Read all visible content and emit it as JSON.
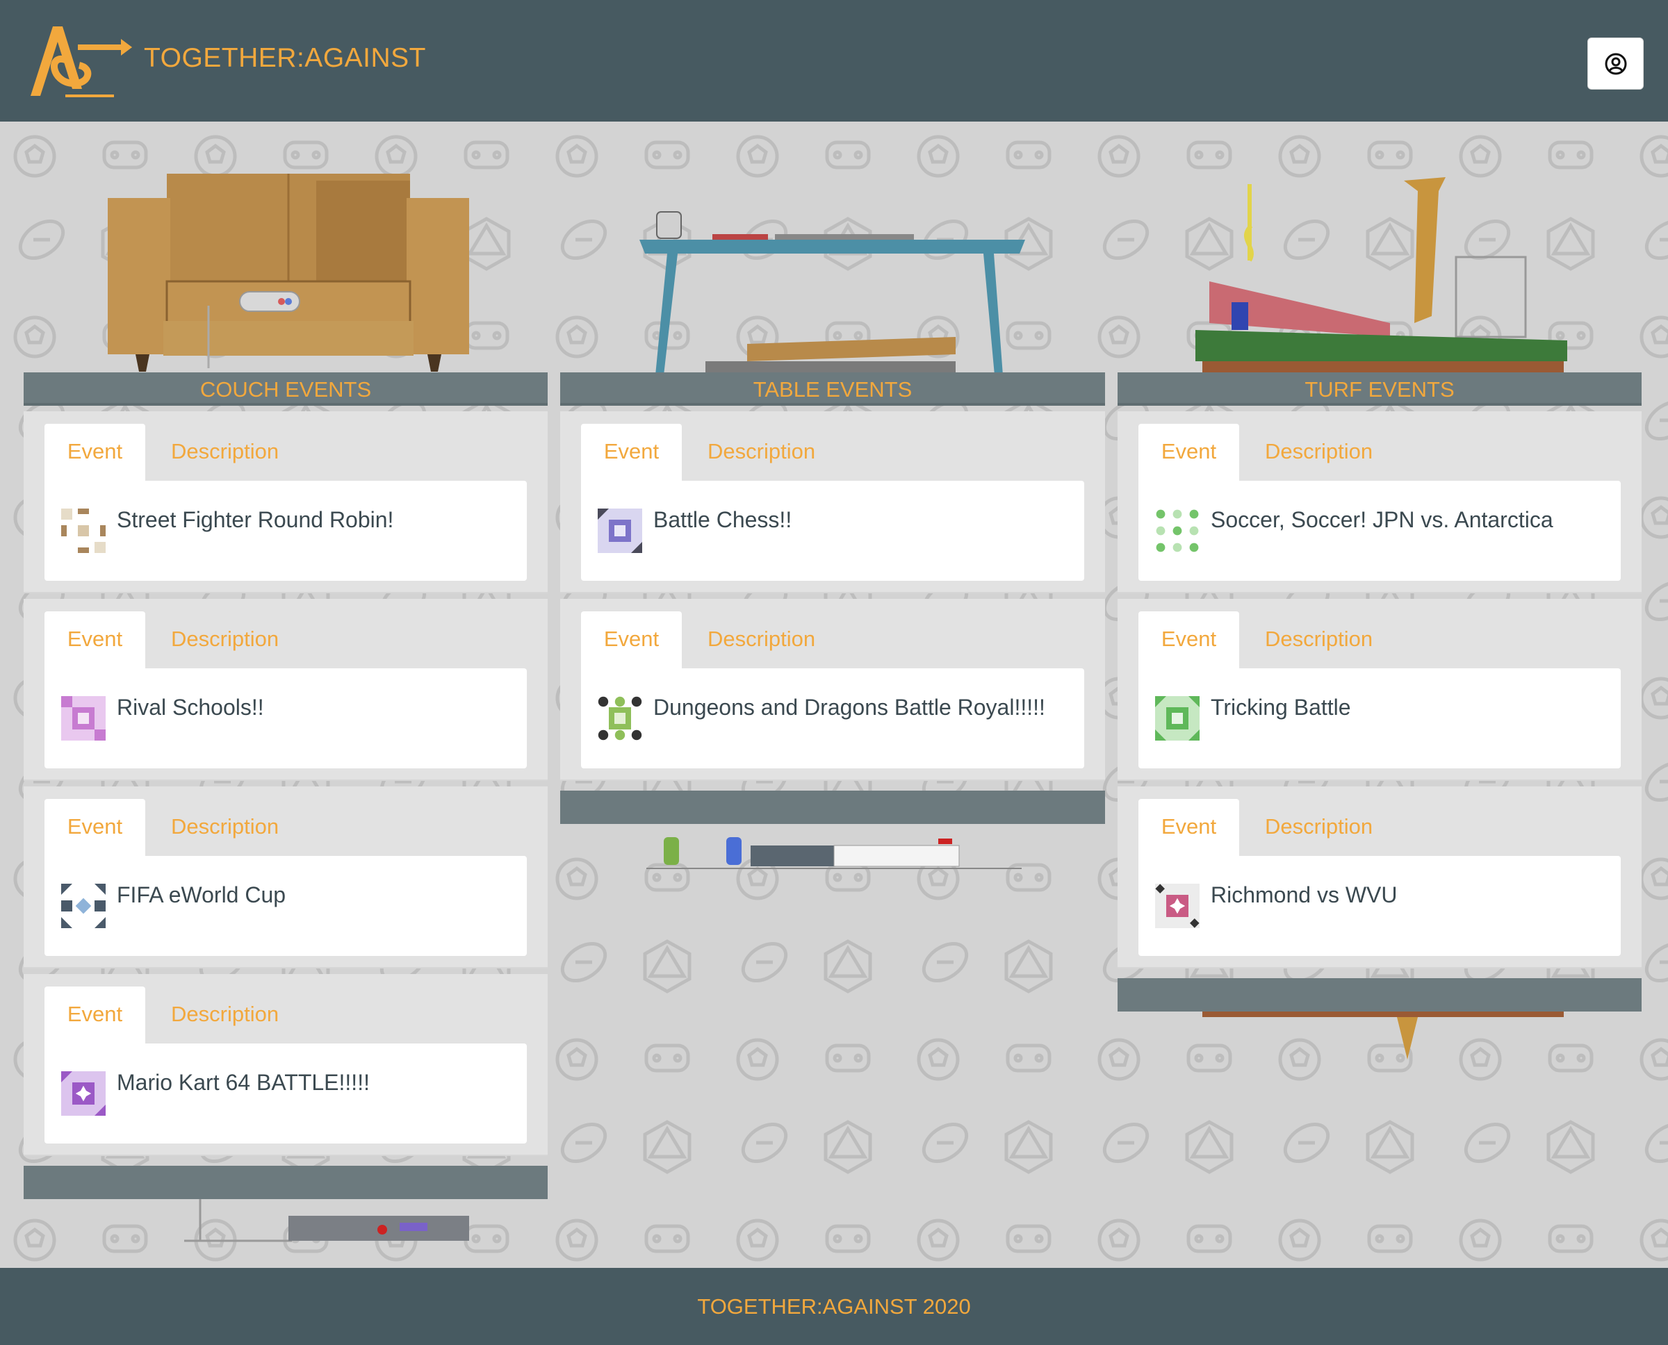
{
  "brand": {
    "name": "TOGETHER:AGAINST"
  },
  "header": {
    "account_icon": "user-circle-icon"
  },
  "columns": [
    {
      "title": "COUCH EVENTS",
      "events": [
        {
          "tab_event": "Event",
          "tab_description": "Description",
          "title": "Street Fighter Round Robin!",
          "avatar_color": "#a9865c"
        },
        {
          "tab_event": "Event",
          "tab_description": "Description",
          "title": "Rival Schools!!",
          "avatar_color": "#c77bd1"
        },
        {
          "tab_event": "Event",
          "tab_description": "Description",
          "title": "FIFA eWorld Cup",
          "avatar_color": "#4a5a6a"
        },
        {
          "tab_event": "Event",
          "tab_description": "Description",
          "title": "Mario Kart 64 BATTLE!!!!!",
          "avatar_color": "#9b59c6"
        }
      ]
    },
    {
      "title": "TABLE EVENTS",
      "events": [
        {
          "tab_event": "Event",
          "tab_description": "Description",
          "title": "Battle Chess!!",
          "avatar_color": "#7d74c9"
        },
        {
          "tab_event": "Event",
          "tab_description": "Description",
          "title": "Dungeons and Dragons Battle Royal!!!!!",
          "avatar_color": "#8fbf5a"
        }
      ]
    },
    {
      "title": "TURF EVENTS",
      "events": [
        {
          "tab_event": "Event",
          "tab_description": "Description",
          "title": "Soccer, Soccer! JPN vs. Antarctica",
          "avatar_color": "#74c46a"
        },
        {
          "tab_event": "Event",
          "tab_description": "Description",
          "title": "Tricking Battle",
          "avatar_color": "#5fb85a"
        },
        {
          "tab_event": "Event",
          "tab_description": "Description",
          "title": "Richmond vs WVU",
          "avatar_color": "#c95b84"
        }
      ]
    }
  ],
  "footer": {
    "text": "TOGETHER:AGAINST 2020"
  },
  "colors": {
    "header_bg": "#475a61",
    "accent": "#f2a83d",
    "column_header_bg": "#6c7a7e"
  }
}
